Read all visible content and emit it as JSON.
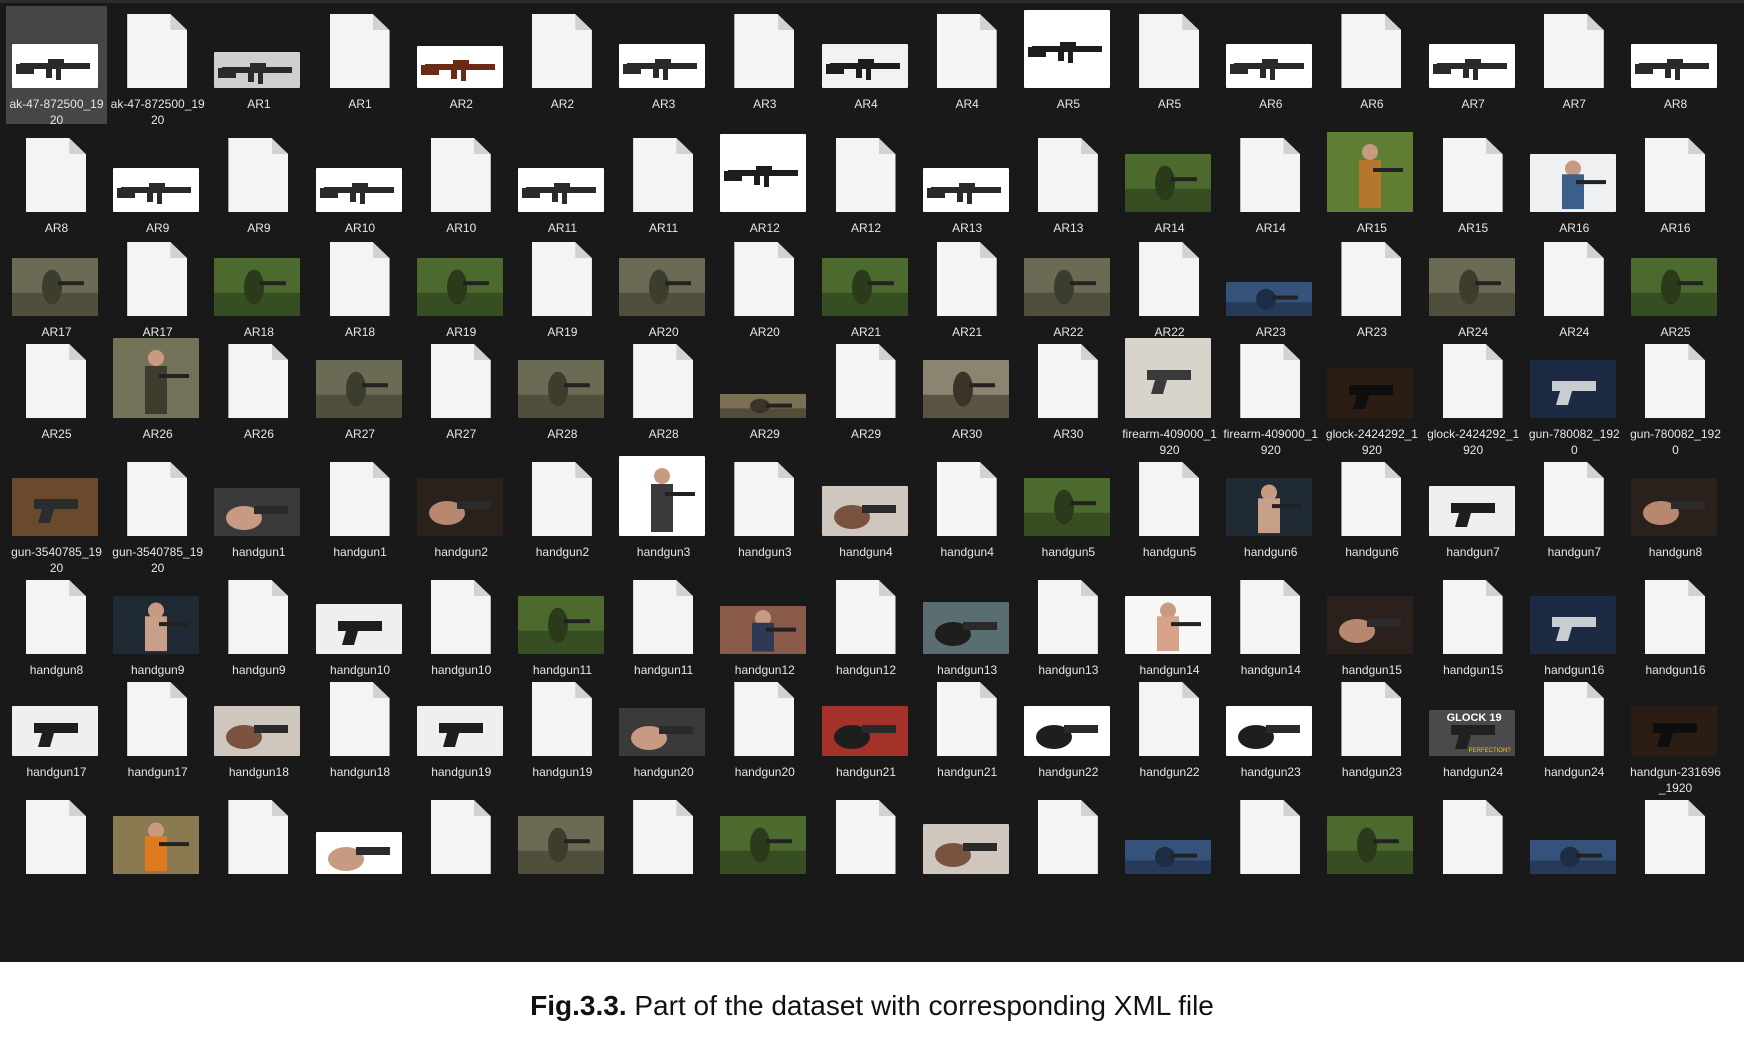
{
  "explorer": {
    "rows": [
      [
        {
          "label": "ak-47-872500_1920",
          "kind": "photo",
          "scene": "rifle-white",
          "selected": true
        },
        {
          "label": "ak-47-872500_1920",
          "kind": "file"
        },
        {
          "label": "AR1",
          "kind": "photo",
          "scene": "rifle-grey"
        },
        {
          "label": "AR1",
          "kind": "file"
        },
        {
          "label": "AR2",
          "kind": "photo",
          "scene": "ak-white"
        },
        {
          "label": "AR2",
          "kind": "file"
        },
        {
          "label": "AR3",
          "kind": "photo",
          "scene": "rifle-white"
        },
        {
          "label": "AR3",
          "kind": "file"
        },
        {
          "label": "AR4",
          "kind": "photo",
          "scene": "rifle-scope"
        },
        {
          "label": "AR4",
          "kind": "file"
        },
        {
          "label": "AR5",
          "kind": "photo",
          "scene": "rifle-white-big"
        },
        {
          "label": "AR5",
          "kind": "file"
        },
        {
          "label": "AR6",
          "kind": "photo",
          "scene": "rifle-white"
        },
        {
          "label": "AR6",
          "kind": "file"
        },
        {
          "label": "AR7",
          "kind": "photo",
          "scene": "rifle-white"
        },
        {
          "label": "AR7",
          "kind": "file"
        },
        {
          "label": "AR8",
          "kind": "photo",
          "scene": "rifle-white"
        }
      ],
      [
        {
          "label": "AR8",
          "kind": "file"
        },
        {
          "label": "AR9",
          "kind": "photo",
          "scene": "rifle-white"
        },
        {
          "label": "AR9",
          "kind": "file"
        },
        {
          "label": "AR10",
          "kind": "photo",
          "scene": "rifle-white"
        },
        {
          "label": "AR10",
          "kind": "file"
        },
        {
          "label": "AR11",
          "kind": "photo",
          "scene": "rifle-white"
        },
        {
          "label": "AR11",
          "kind": "file"
        },
        {
          "label": "AR12",
          "kind": "photo",
          "scene": "rifle-white-big"
        },
        {
          "label": "AR12",
          "kind": "file"
        },
        {
          "label": "AR13",
          "kind": "photo",
          "scene": "rifle-white"
        },
        {
          "label": "AR13",
          "kind": "file"
        },
        {
          "label": "AR14",
          "kind": "photo",
          "scene": "forest"
        },
        {
          "label": "AR14",
          "kind": "file"
        },
        {
          "label": "AR15",
          "kind": "photo",
          "scene": "person-green-tall"
        },
        {
          "label": "AR15",
          "kind": "file"
        },
        {
          "label": "AR16",
          "kind": "photo",
          "scene": "person-white"
        },
        {
          "label": "AR16",
          "kind": "file"
        }
      ],
      [
        {
          "label": "AR17",
          "kind": "photo",
          "scene": "soldier"
        },
        {
          "label": "AR17",
          "kind": "file"
        },
        {
          "label": "AR18",
          "kind": "photo",
          "scene": "forest"
        },
        {
          "label": "AR18",
          "kind": "file"
        },
        {
          "label": "AR19",
          "kind": "photo",
          "scene": "forest"
        },
        {
          "label": "AR19",
          "kind": "file"
        },
        {
          "label": "AR20",
          "kind": "photo",
          "scene": "soldier"
        },
        {
          "label": "AR20",
          "kind": "file"
        },
        {
          "label": "AR21",
          "kind": "photo",
          "scene": "forest"
        },
        {
          "label": "AR21",
          "kind": "file"
        },
        {
          "label": "AR22",
          "kind": "photo",
          "scene": "soldier"
        },
        {
          "label": "AR22",
          "kind": "file"
        },
        {
          "label": "AR23",
          "kind": "photo",
          "scene": "blue"
        },
        {
          "label": "AR23",
          "kind": "file"
        },
        {
          "label": "AR24",
          "kind": "photo",
          "scene": "soldier"
        },
        {
          "label": "AR24",
          "kind": "file"
        },
        {
          "label": "AR25",
          "kind": "photo",
          "scene": "forest"
        }
      ],
      [
        {
          "label": "AR25",
          "kind": "file"
        },
        {
          "label": "AR26",
          "kind": "photo",
          "scene": "soldier-tall"
        },
        {
          "label": "AR26",
          "kind": "file"
        },
        {
          "label": "AR27",
          "kind": "photo",
          "scene": "soldier"
        },
        {
          "label": "AR27",
          "kind": "file"
        },
        {
          "label": "AR28",
          "kind": "photo",
          "scene": "soldier"
        },
        {
          "label": "AR28",
          "kind": "file"
        },
        {
          "label": "AR29",
          "kind": "photo",
          "scene": "field-small"
        },
        {
          "label": "AR29",
          "kind": "file"
        },
        {
          "label": "AR30",
          "kind": "photo",
          "scene": "field"
        },
        {
          "label": "AR30",
          "kind": "file"
        },
        {
          "label": "firearm-409000_1920",
          "kind": "photo",
          "scene": "revolver-tall"
        },
        {
          "label": "firearm-409000_1920",
          "kind": "file"
        },
        {
          "label": "glock-2424292_1920",
          "kind": "photo",
          "scene": "dark-pistol"
        },
        {
          "label": "glock-2424292_1920",
          "kind": "file"
        },
        {
          "label": "gun-780082_1920",
          "kind": "photo",
          "scene": "silver-pistol"
        },
        {
          "label": "gun-780082_1920",
          "kind": "file"
        }
      ],
      [
        {
          "label": "gun-3540785_1920",
          "kind": "photo",
          "scene": "wood"
        },
        {
          "label": "gun-3540785_1920",
          "kind": "file"
        },
        {
          "label": "handgun1",
          "kind": "photo",
          "scene": "hand-grey"
        },
        {
          "label": "handgun1",
          "kind": "file"
        },
        {
          "label": "handgun2",
          "kind": "photo",
          "scene": "hand-dark"
        },
        {
          "label": "handgun2",
          "kind": "file"
        },
        {
          "label": "handgun3",
          "kind": "photo",
          "scene": "suit-tall"
        },
        {
          "label": "handgun3",
          "kind": "file"
        },
        {
          "label": "handgun4",
          "kind": "photo",
          "scene": "hand-light"
        },
        {
          "label": "handgun4",
          "kind": "file"
        },
        {
          "label": "handgun5",
          "kind": "photo",
          "scene": "forest"
        },
        {
          "label": "handgun5",
          "kind": "file"
        },
        {
          "label": "handgun6",
          "kind": "photo",
          "scene": "dark-person"
        },
        {
          "label": "handgun6",
          "kind": "file"
        },
        {
          "label": "handgun7",
          "kind": "photo",
          "scene": "pistol-white"
        },
        {
          "label": "handgun7",
          "kind": "file"
        },
        {
          "label": "handgun8",
          "kind": "photo",
          "scene": "hand-dark"
        }
      ],
      [
        {
          "label": "handgun8",
          "kind": "file"
        },
        {
          "label": "handgun9",
          "kind": "photo",
          "scene": "dark-person"
        },
        {
          "label": "handgun9",
          "kind": "file"
        },
        {
          "label": "handgun10",
          "kind": "photo",
          "scene": "pistol-white"
        },
        {
          "label": "handgun10",
          "kind": "file"
        },
        {
          "label": "handgun11",
          "kind": "photo",
          "scene": "forest"
        },
        {
          "label": "handgun11",
          "kind": "file"
        },
        {
          "label": "handgun12",
          "kind": "photo",
          "scene": "brick"
        },
        {
          "label": "handgun12",
          "kind": "file"
        },
        {
          "label": "handgun13",
          "kind": "photo",
          "scene": "water"
        },
        {
          "label": "handgun13",
          "kind": "file"
        },
        {
          "label": "handgun14",
          "kind": "photo",
          "scene": "face-white"
        },
        {
          "label": "handgun14",
          "kind": "file"
        },
        {
          "label": "handgun15",
          "kind": "photo",
          "scene": "hand-dark"
        },
        {
          "label": "handgun15",
          "kind": "file"
        },
        {
          "label": "handgun16",
          "kind": "photo",
          "scene": "silver-pistol"
        },
        {
          "label": "handgun16",
          "kind": "file"
        }
      ],
      [
        {
          "label": "handgun17",
          "kind": "photo",
          "scene": "pistol-white"
        },
        {
          "label": "handgun17",
          "kind": "file"
        },
        {
          "label": "handgun18",
          "kind": "photo",
          "scene": "hand-light"
        },
        {
          "label": "handgun18",
          "kind": "file"
        },
        {
          "label": "handgun19",
          "kind": "photo",
          "scene": "pistol-white"
        },
        {
          "label": "handgun19",
          "kind": "file"
        },
        {
          "label": "handgun20",
          "kind": "photo",
          "scene": "hand-grey"
        },
        {
          "label": "handgun20",
          "kind": "file"
        },
        {
          "label": "handgun21",
          "kind": "photo",
          "scene": "red"
        },
        {
          "label": "handgun21",
          "kind": "file"
        },
        {
          "label": "handgun22",
          "kind": "photo",
          "scene": "hand-white"
        },
        {
          "label": "handgun22",
          "kind": "file"
        },
        {
          "label": "handgun23",
          "kind": "photo",
          "scene": "hand-white"
        },
        {
          "label": "handgun23",
          "kind": "file"
        },
        {
          "label": "handgun24",
          "kind": "photo",
          "scene": "glock19",
          "overlay": "GLOCK 19",
          "overlay2": "PERFECTION?"
        },
        {
          "label": "handgun24",
          "kind": "file"
        },
        {
          "label": "handgun-231696_1920",
          "kind": "photo",
          "scene": "dark-pistol"
        }
      ],
      [
        {
          "label": "",
          "kind": "file"
        },
        {
          "label": "",
          "kind": "photo",
          "scene": "hunter"
        },
        {
          "label": "",
          "kind": "file"
        },
        {
          "label": "",
          "kind": "photo",
          "scene": "knife"
        },
        {
          "label": "",
          "kind": "file"
        },
        {
          "label": "",
          "kind": "photo",
          "scene": "soldier"
        },
        {
          "label": "",
          "kind": "file"
        },
        {
          "label": "",
          "kind": "photo",
          "scene": "forest"
        },
        {
          "label": "",
          "kind": "file"
        },
        {
          "label": "",
          "kind": "photo",
          "scene": "hand-light"
        },
        {
          "label": "",
          "kind": "file"
        },
        {
          "label": "",
          "kind": "photo",
          "scene": "blue"
        },
        {
          "label": "",
          "kind": "file"
        },
        {
          "label": "",
          "kind": "photo",
          "scene": "forest"
        },
        {
          "label": "",
          "kind": "file"
        },
        {
          "label": "",
          "kind": "photo",
          "scene": "blue"
        },
        {
          "label": "",
          "kind": "file"
        }
      ]
    ]
  },
  "caption": {
    "bold": "Fig.3.3.",
    "text": " Part of the dataset with  corresponding XML file"
  }
}
